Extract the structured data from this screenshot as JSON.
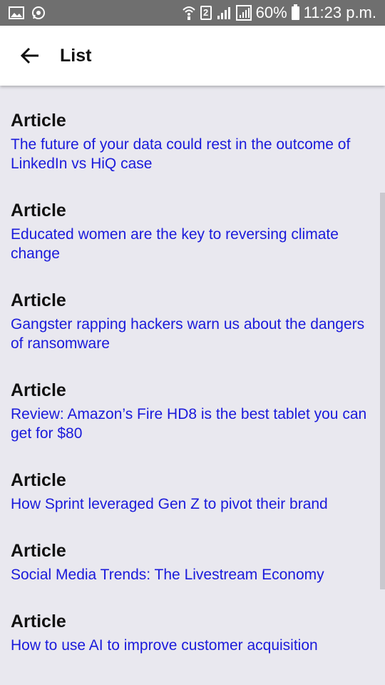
{
  "status_bar": {
    "battery_percent": "60%",
    "time": "11:23 p.m.",
    "sim_slot": "2",
    "icons": [
      "gallery-icon",
      "whatsapp-icon",
      "wifi-calling-icon",
      "sim-icon",
      "signal-icon",
      "signal-2-icon",
      "battery-icon"
    ]
  },
  "app_bar": {
    "title": "List",
    "back_icon": "arrow-back-icon"
  },
  "list": {
    "items": [
      {
        "type": "Article",
        "title": "The future of your data could rest in the outcome of LinkedIn vs HiQ case"
      },
      {
        "type": "Article",
        "title": "Educated women are the key to reversing climate change"
      },
      {
        "type": "Article",
        "title": "Gangster rapping hackers warn us about the dangers of ransomware"
      },
      {
        "type": "Article",
        "title": "Review: Amazon’s Fire HD8 is the best tablet you can get for $80"
      },
      {
        "type": "Article",
        "title": "How Sprint leveraged Gen Z to pivot their brand"
      },
      {
        "type": "Article",
        "title": "Social Media Trends: The Livestream Economy"
      },
      {
        "type": "Article",
        "title": "How to use AI to improve customer acquisition"
      }
    ]
  },
  "colors": {
    "status_bar": "#6f6f6f",
    "background": "#e9e8ef",
    "link": "#1a1adb"
  }
}
